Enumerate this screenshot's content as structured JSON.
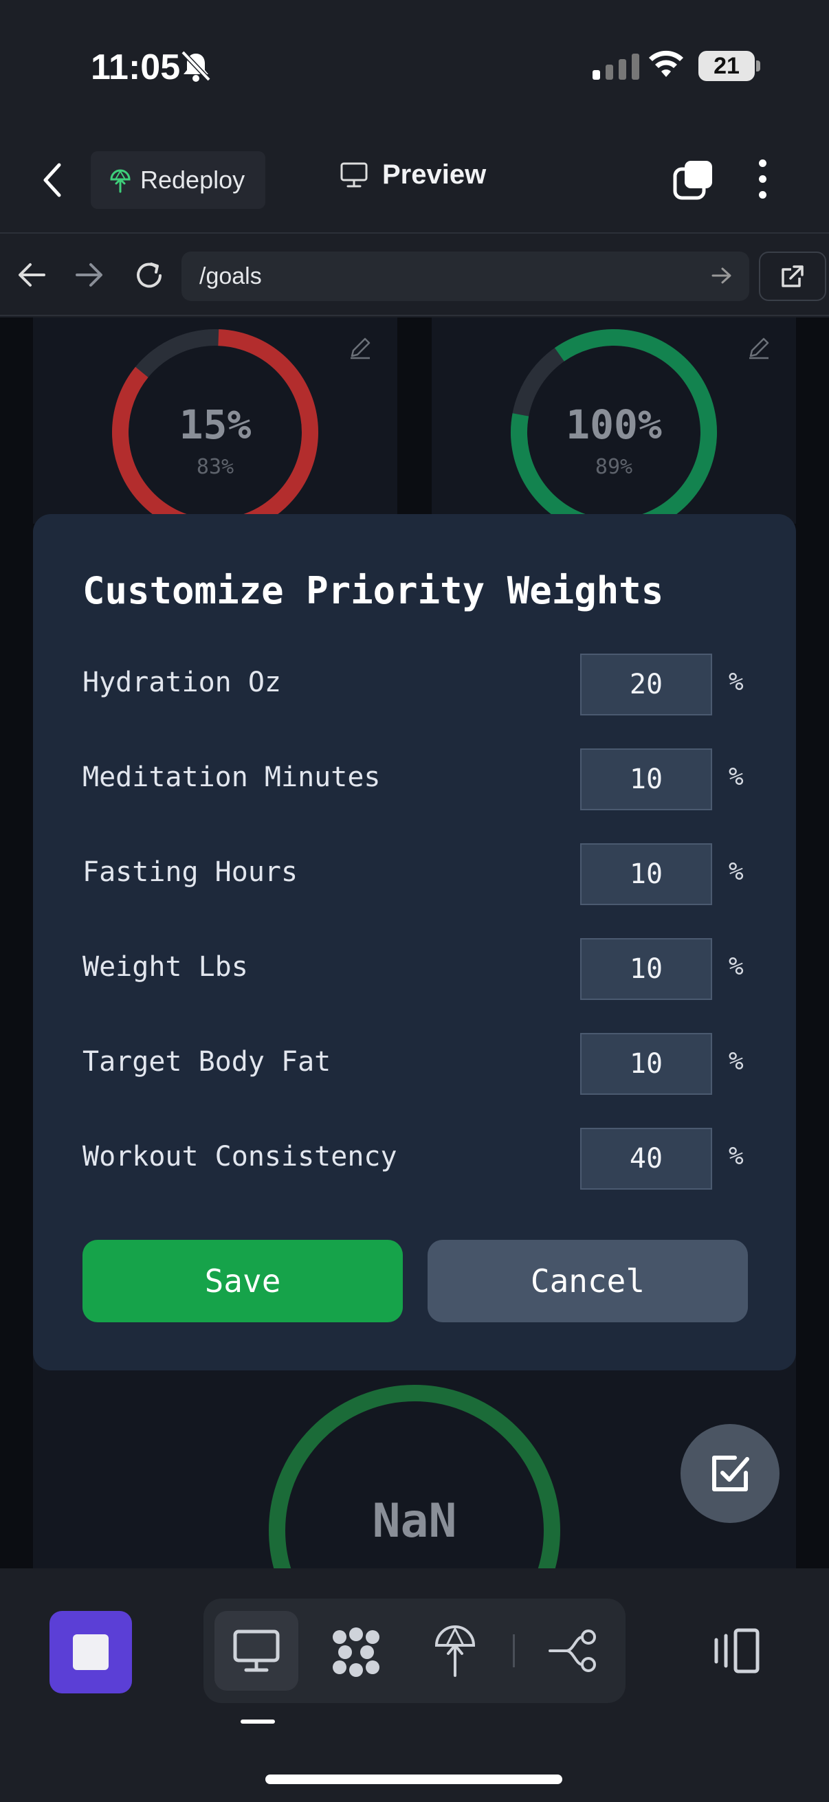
{
  "status_bar": {
    "time": "11:05",
    "battery": "21"
  },
  "header": {
    "redeploy_label": "Redeploy",
    "title": "Preview"
  },
  "browser": {
    "url": "/goals"
  },
  "goal_cards": [
    {
      "value": "15%",
      "sub": "83%"
    },
    {
      "value": "100%",
      "sub": "89%"
    },
    {
      "value": "NaN"
    }
  ],
  "modal": {
    "title": "Customize Priority Weights",
    "unit": "%",
    "rows": [
      {
        "label": "Hydration Oz",
        "value": "20"
      },
      {
        "label": "Meditation Minutes",
        "value": "10"
      },
      {
        "label": "Fasting Hours",
        "value": "10"
      },
      {
        "label": "Weight Lbs",
        "value": "10"
      },
      {
        "label": "Target Body Fat",
        "value": "10"
      },
      {
        "label": "Workout Consistency",
        "value": "40"
      }
    ],
    "save_label": "Save",
    "cancel_label": "Cancel"
  },
  "colors": {
    "accent_save": "#16a34a",
    "cancel": "#475569",
    "stop_button": "#5b3fd6",
    "gauge_red": "#b32d2d",
    "gauge_green": "#13834f"
  }
}
